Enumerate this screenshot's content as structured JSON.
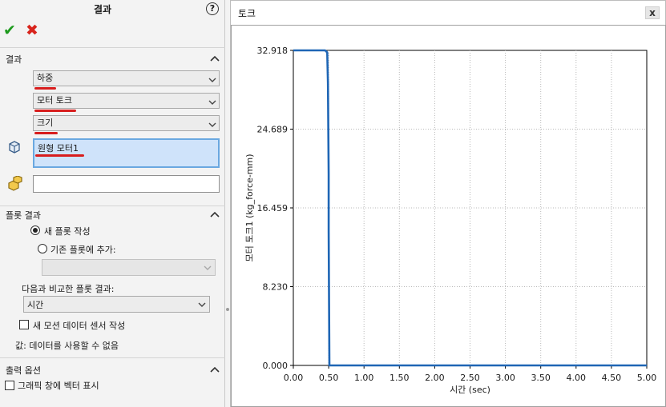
{
  "panel": {
    "title": "결과",
    "help_glyph": "?",
    "ok_glyph": "✔",
    "cancel_glyph": "✖",
    "results_section": {
      "title": "결과",
      "combos": [
        {
          "value": "하중"
        },
        {
          "value": "모터 토크"
        },
        {
          "value": "크기"
        }
      ],
      "motor_list_item": "원형 모터1",
      "reference_input_value": ""
    },
    "plot_results_section": {
      "title": "플롯 결과",
      "new_plot_label": "새 플롯 작성",
      "add_existing_label": "기존 플롯에 추가:",
      "compare_label": "다음과 비교한 플롯 결과:",
      "compare_value": "시간",
      "sensor_label": "새 모션 데이터 센서 작성",
      "value_text": "값: 데이터를 사용할 수 없음"
    },
    "output_section": {
      "title": "출력 옵션",
      "vector_label": "그래픽 창에 벡터 표시"
    },
    "icons": {
      "help": "help-icon",
      "ok": "checkmark-icon",
      "cancel": "cross-icon",
      "motor": "motor-part-icon",
      "reference": "reference-component-icon",
      "collapse": "chevron-up-icon",
      "dropdown": "chevron-down-icon"
    },
    "colors": {
      "ok": "#1d9a1d",
      "cancel": "#d8241c",
      "highlight_mark": "#d81d1d",
      "selection_fill": "#cfe3fa",
      "selection_border": "#6aa8e0"
    }
  },
  "plot_window": {
    "title": "토크",
    "close_glyph": "x"
  },
  "chart_data": {
    "type": "line",
    "xlabel": "시간 (sec)",
    "ylabel": "모터 토크1 (kg_force-mm)",
    "xlim": [
      0,
      5
    ],
    "ylim": [
      0,
      32.918
    ],
    "x_ticks": [
      "0.00",
      "0.50",
      "1.00",
      "1.50",
      "2.00",
      "2.50",
      "3.00",
      "3.50",
      "4.00",
      "4.50",
      "5.00"
    ],
    "y_ticks": [
      "0.000",
      "8.230",
      "16.459",
      "24.689",
      "32.918"
    ],
    "grid": true,
    "line_color": "#1f66b5",
    "series": [
      {
        "x": [
          0,
          0.45,
          0.48,
          0.49,
          0.5,
          0.5,
          0.51,
          5.0
        ],
        "y": [
          32.918,
          32.918,
          32.7,
          29.5,
          20.0,
          14.0,
          0.0,
          0.0
        ]
      }
    ]
  }
}
